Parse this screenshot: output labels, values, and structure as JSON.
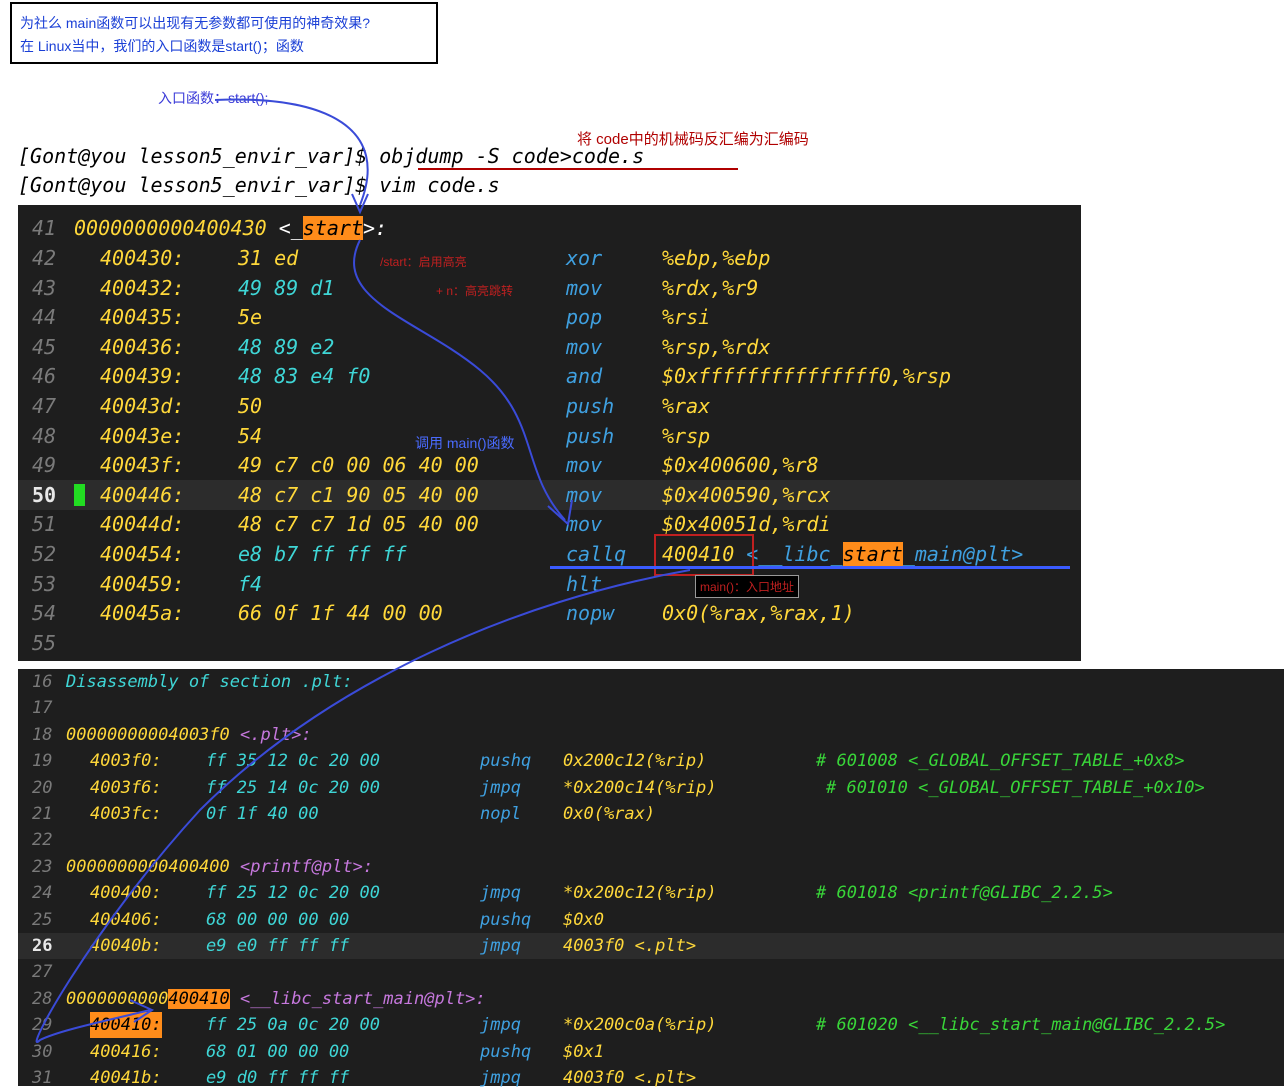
{
  "notes": {
    "line1": "为社么 main函数可以出现有无参数都可使用的神奇效果?",
    "line2": "在 Linux当中，我们的入口函数是start()；函数",
    "entry_label": "入口函数：start();",
    "objdump_note": "将 code中的机械码反汇编为汇编码",
    "start_highlight_note": "/start：启用高亮",
    "jump_note": "+ n：高亮跳转",
    "call_main_note": "调用 main()函数",
    "main_entry_note": "main()：入口地址"
  },
  "shell": {
    "cmd1": "[Gont@you lesson5_envir_var]$ objdump -S code>code.s",
    "cmd2": "[Gont@you lesson5_envir_var]$ vim code.s"
  },
  "term1": {
    "header": {
      "ln": "41",
      "addr": "0000000000400430",
      "pre": " <_",
      "sym": "start",
      "post": ">:"
    },
    "rows": [
      {
        "ln": "42",
        "addr": "400430:",
        "bytes": "31 ed",
        "mn": "xor",
        "op": "%ebp,%ebp"
      },
      {
        "ln": "43",
        "addr": "400432:",
        "bytes": "49 89 d1",
        "mn": "mov",
        "op": "%rdx,%r9"
      },
      {
        "ln": "44",
        "addr": "400435:",
        "bytes": "5e",
        "mn": "pop",
        "op": "%rsi"
      },
      {
        "ln": "45",
        "addr": "400436:",
        "bytes": "48 89 e2",
        "mn": "mov",
        "op": "%rsp,%rdx"
      },
      {
        "ln": "46",
        "addr": "400439:",
        "bytes": "48 83 e4 f0",
        "mn": "and",
        "op": "$0xfffffffffffffff0,%rsp"
      },
      {
        "ln": "47",
        "addr": "40043d:",
        "bytes": "50",
        "mn": "push",
        "op": "%rax"
      },
      {
        "ln": "48",
        "addr": "40043e:",
        "bytes": "54",
        "mn": "push",
        "op": "%rsp"
      },
      {
        "ln": "49",
        "addr": "40043f:",
        "bytes": "49 c7 c0 00 06 40 00",
        "mn": "mov",
        "op": "$0x400600,%r8"
      },
      {
        "ln": "50",
        "addr": "400446:",
        "bytes": "48 c7 c1 90 05 40 00",
        "mn": "mov",
        "op": "$0x400590,%rcx"
      },
      {
        "ln": "51",
        "addr": "40044d:",
        "bytes": "48 c7 c7 1d 05 40 00",
        "mn": "mov",
        "op": "$0x40051d,%rdi"
      },
      {
        "ln": "52",
        "addr": "400454:",
        "bytes": "e8 b7 ff ff ff",
        "mn": "callq",
        "op": "400410 <__libc_start_main@plt>"
      },
      {
        "ln": "53",
        "addr": "400459:",
        "bytes": "f4",
        "mn": "hlt",
        "op": ""
      },
      {
        "ln": "54",
        "addr": "40045a:",
        "bytes": "66 0f 1f 44 00 00",
        "mn": "nopw",
        "op": "0x0(%rax,%rax,1)"
      },
      {
        "ln": "55",
        "addr": "",
        "bytes": "",
        "mn": "",
        "op": ""
      }
    ],
    "callq_target": "400410",
    "callq_sym_pre": " <__libc_",
    "callq_sym_hl": "start",
    "callq_sym_post": "_main@plt>"
  },
  "term2": {
    "rows": [
      {
        "ln": "16",
        "text": "Disassembly of section .plt:",
        "kind": "heading"
      },
      {
        "ln": "17",
        "text": "",
        "kind": "blank"
      },
      {
        "ln": "18",
        "addr": "00000000004003f0",
        "label": " <.plt>:",
        "kind": "label"
      },
      {
        "ln": "19",
        "addr": "4003f0:",
        "bytes": "ff 35 12 0c 20 00",
        "mn": "pushq",
        "op": "0x200c12(%rip)",
        "cmt": "# 601008 <_GLOBAL_OFFSET_TABLE_+0x8>",
        "kind": "ins"
      },
      {
        "ln": "20",
        "addr": "4003f6:",
        "bytes": "ff 25 14 0c 20 00",
        "mn": "jmpq",
        "op": "*0x200c14(%rip)",
        "cmt": "# 601010 <_GLOBAL_OFFSET_TABLE_+0x10>",
        "kind": "ins"
      },
      {
        "ln": "21",
        "addr": "4003fc:",
        "bytes": "0f 1f 40 00",
        "mn": "nopl",
        "op": "0x0(%rax)",
        "cmt": "",
        "kind": "ins"
      },
      {
        "ln": "22",
        "text": "",
        "kind": "blank"
      },
      {
        "ln": "23",
        "addr": "0000000000400400",
        "label": " <printf@plt>:",
        "kind": "label"
      },
      {
        "ln": "24",
        "addr": "400400:",
        "bytes": "ff 25 12 0c 20 00",
        "mn": "jmpq",
        "op": "*0x200c12(%rip)",
        "cmt": "# 601018 <printf@GLIBC_2.2.5>",
        "kind": "ins"
      },
      {
        "ln": "25",
        "addr": "400406:",
        "bytes": "68 00 00 00 00",
        "mn": "pushq",
        "op": "$0x0",
        "cmt": "",
        "kind": "ins"
      },
      {
        "ln": "26",
        "addr": "40040b:",
        "bytes": "e9 e0 ff ff ff",
        "mn": "jmpq",
        "op": "4003f0 <.plt>",
        "cmt": "",
        "kind": "ins"
      },
      {
        "ln": "27",
        "text": "",
        "kind": "blank"
      },
      {
        "ln": "28",
        "addr_pre": "0000000000",
        "addr_hl": "400410",
        "label": " <__libc_start_main@plt>:",
        "kind": "label-hl"
      },
      {
        "ln": "29",
        "addr": "400410:",
        "bytes": "ff 25 0a 0c 20 00",
        "mn": "jmpq",
        "op": "*0x200c0a(%rip)",
        "cmt": "# 601020 <__libc_start_main@GLIBC_2.2.5>",
        "kind": "ins"
      },
      {
        "ln": "30",
        "addr": "400416:",
        "bytes": "68 01 00 00 00",
        "mn": "pushq",
        "op": "$0x1",
        "cmt": "",
        "kind": "ins"
      },
      {
        "ln": "31",
        "addr": "40041b:",
        "bytes": "e9 d0 ff ff ff",
        "mn": "jmpq",
        "op": "4003f0 <.plt>",
        "cmt": "",
        "kind": "ins"
      }
    ]
  },
  "colors": {
    "terminal_bg": "#1e1e1e",
    "address": "#ffd83a",
    "bytes": "#3fd6d6",
    "mnemonic": "#3fa0e0",
    "comment": "#39d639",
    "highlight": "#ff8c1a",
    "annotation_blue": "#3a5bff"
  }
}
